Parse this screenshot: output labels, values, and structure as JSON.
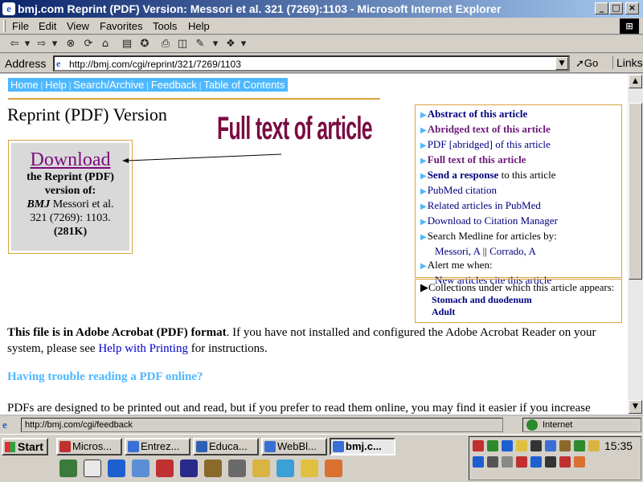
{
  "window": {
    "title": "bmj.com Reprint (PDF) Version: Messori et al. 321 (7269):1103 - Microsoft Internet Explorer",
    "buttons": {
      "minimize": "_",
      "maximize": "□",
      "close": "×"
    }
  },
  "menu": {
    "items": [
      "File",
      "Edit",
      "View",
      "Favorites",
      "Tools",
      "Help"
    ]
  },
  "toolbar": {
    "icons": [
      "back-icon",
      "forward-icon",
      "stop-icon",
      "refresh-icon",
      "home-icon",
      "search-icon",
      "favorites-icon",
      "print-icon",
      "preview-icon",
      "edit-icon",
      "discuss-icon"
    ]
  },
  "address": {
    "label": "Address",
    "url": "http://bmj.com/cgi/reprint/321/7269/1103",
    "go": "Go",
    "links": "Links"
  },
  "nav": {
    "items": [
      "Home",
      "Help",
      "Search/Archive",
      "Feedback",
      "Table of Contents"
    ]
  },
  "page": {
    "title": "Reprint (PDF) Version",
    "annotation": "Full text of article",
    "download": {
      "link": "Download",
      "line1": "the Reprint (PDF)",
      "line2": "version of:",
      "journal": "BMJ",
      "authors": "Messori et al.",
      "citation": "321 (7269): 1103.",
      "size": "(281K)"
    },
    "sidebar": {
      "abstract": "Abstract of this article",
      "abridged": "Abridged text of this article",
      "pdf_abridged": "PDF [abridged] of this article",
      "fulltext": "Full text of this article",
      "send_response": "Send a response",
      "send_response_suffix": " to this article",
      "pubmed": "PubMed citation",
      "related": "Related articles in PubMed",
      "citation_mgr": "Download to Citation Manager",
      "search_medline": "Search Medline for articles by:",
      "author1": "Messori, A",
      "author_sep": " || ",
      "author2": "Corrado, A",
      "alert": "Alert me when:",
      "new_articles": "New articles cite this article"
    },
    "collections": {
      "label": "Collections under which this article appears:",
      "items": [
        "Stomach and duodenum",
        "Adult"
      ]
    },
    "p1_bold": "This file is in Adobe Acrobat (PDF) format",
    "p1_rest": ". If you have not installed and configured the Adobe Acrobat Reader on your system, please see ",
    "p1_link": "Help with Printing",
    "p1_end": " for instructions.",
    "trouble": "Having trouble reading a PDF online?",
    "p2": "PDFs are designed to be printed out and read, but if you prefer to read them online, you may find it easier if you increase"
  },
  "status": {
    "text": "http://bmj.com/cgi/feedback",
    "zone": "Internet"
  },
  "taskbar": {
    "start": "Start",
    "tasks": [
      "Micros...",
      "Entrez...",
      "Educa...",
      "WebBl...",
      "bmj.c..."
    ],
    "clock": "15:35"
  },
  "colors": {
    "nav_bg": "#4db8ff",
    "gold_rule": "#d9a441",
    "annotation": "#7a0b41",
    "link": "#000080",
    "visited": "#6b1a78"
  }
}
